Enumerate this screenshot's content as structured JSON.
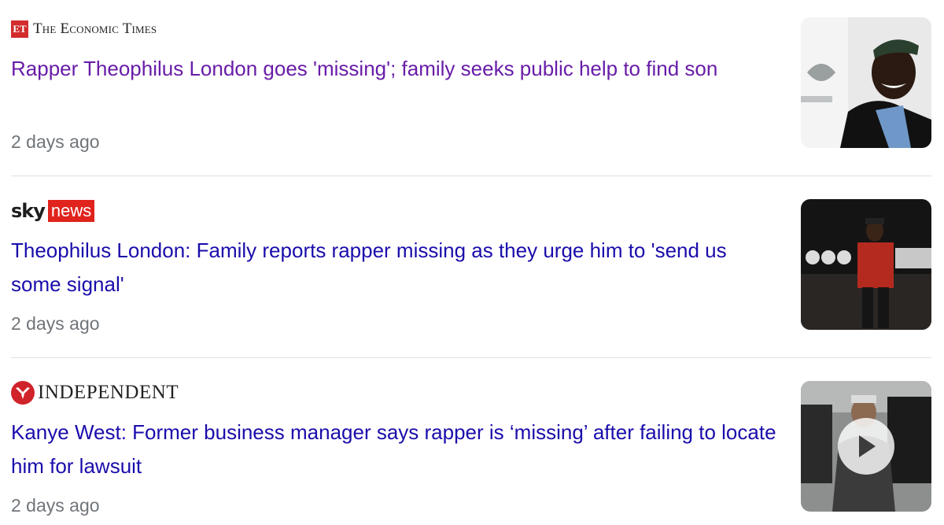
{
  "articles": [
    {
      "source": {
        "badge": "ET",
        "name": "The Economic Times",
        "logo_color": "#d22c2c"
      },
      "headline": "Rapper Theophilus London goes 'missing'; family seeks public help to find son",
      "visited": true,
      "time": "2 days ago",
      "thumbnail": {
        "has_video": false
      }
    },
    {
      "source": {
        "name_part1": "sky",
        "name_part2": "news",
        "logo_color": "#e0231d"
      },
      "headline": "Theophilus London: Family reports rapper missing as they urge him to 'send us some signal'",
      "visited": false,
      "time": "2 days ago",
      "thumbnail": {
        "has_video": false
      }
    },
    {
      "source": {
        "name": "INDEPENDENT",
        "logo_color": "#d0232a"
      },
      "headline": "Kanye West: Former business manager says rapper is ‘missing’ after failing to locate him for lawsuit",
      "visited": false,
      "time": "2 days ago",
      "thumbnail": {
        "has_video": true,
        "icon": "play-icon"
      }
    }
  ],
  "colors": {
    "link": "#1a0dab",
    "visited_link": "#681da8",
    "meta_text": "#70757a",
    "divider": "#dfe1e5"
  }
}
